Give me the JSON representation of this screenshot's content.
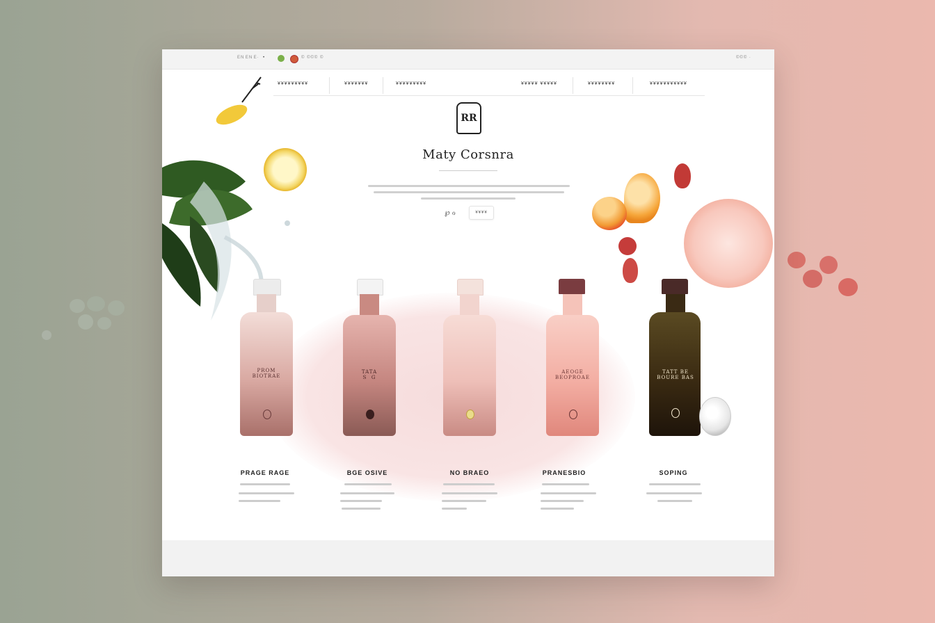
{
  "topbar": {
    "left_text": "EN EN E·",
    "dot_text": "•",
    "right_links": "© ©©© ©",
    "right_text": "©©© ·"
  },
  "nav": {
    "items": [
      "¥¥¥¥¥¥¥¥¥",
      "¥¥¥¥¥¥¥",
      "¥¥¥¥¥¥¥¥¥",
      "¥¥¥¥¥ ¥¥¥¥¥",
      "¥¥¥¥¥¥¥¥",
      "¥¥¥¥¥¥¥¥¥¥¥"
    ]
  },
  "hero": {
    "crest_text": "RR",
    "brand": "Maty Corsnra",
    "cta_icon": "℘ ℴ",
    "cta_label": "¥¥¥¥"
  },
  "products": [
    {
      "bottle_label": "PROM\nBIOTRAE",
      "name": "PRAGE RAGE",
      "color": "#c98f8a"
    },
    {
      "bottle_label": "TATA\nS  G",
      "name": "BGE OSIVE",
      "color": "#b98780"
    },
    {
      "bottle_label": "",
      "name": "NO BRAEO",
      "color": "#efc8c2"
    },
    {
      "bottle_label": "AEOGE\nBEOPROAE",
      "name": "PRANESBIO",
      "color": "#f0aca2"
    },
    {
      "bottle_label": "TATT BE\nBOURE BAS",
      "name": "SOPING",
      "color": "#3a2a14"
    }
  ],
  "colors": {
    "accent_green": "#7bb04a",
    "accent_red": "#d05a3a",
    "page_bg": "#ffffff"
  }
}
